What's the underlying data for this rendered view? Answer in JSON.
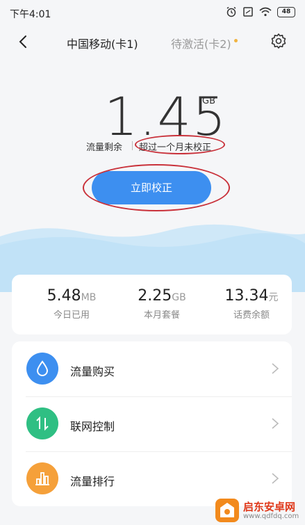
{
  "status_bar": {
    "time": "下午4:01",
    "battery": "48"
  },
  "header": {
    "tab_active": "中国移动(卡1)",
    "tab_inactive": "待激活(卡2)"
  },
  "data_remaining": {
    "value": "1.45",
    "unit": "GB",
    "label": "流量剩余",
    "calibration_status": "超过一个月未校正"
  },
  "calibrate_button": {
    "label": "立即校正"
  },
  "stats": [
    {
      "value": "5.48",
      "unit": "MB",
      "label": "今日已用"
    },
    {
      "value": "2.25",
      "unit": "GB",
      "label": "本月套餐"
    },
    {
      "value": "13.34",
      "unit": "元",
      "label": "话费余额"
    }
  ],
  "menu": [
    {
      "label": "流量购买",
      "icon": "water-drop-icon",
      "color": "#3d8ff0"
    },
    {
      "label": "联网控制",
      "icon": "up-down-arrows-icon",
      "color": "#2fbf83"
    },
    {
      "label": "流量排行",
      "icon": "bar-chart-icon",
      "color": "#f5a03a"
    }
  ],
  "watermark": {
    "name": "启东安卓网",
    "url": "www.qdfdq.com"
  },
  "colors": {
    "accent": "#3d8ff0",
    "highlight": "#c9313a"
  }
}
